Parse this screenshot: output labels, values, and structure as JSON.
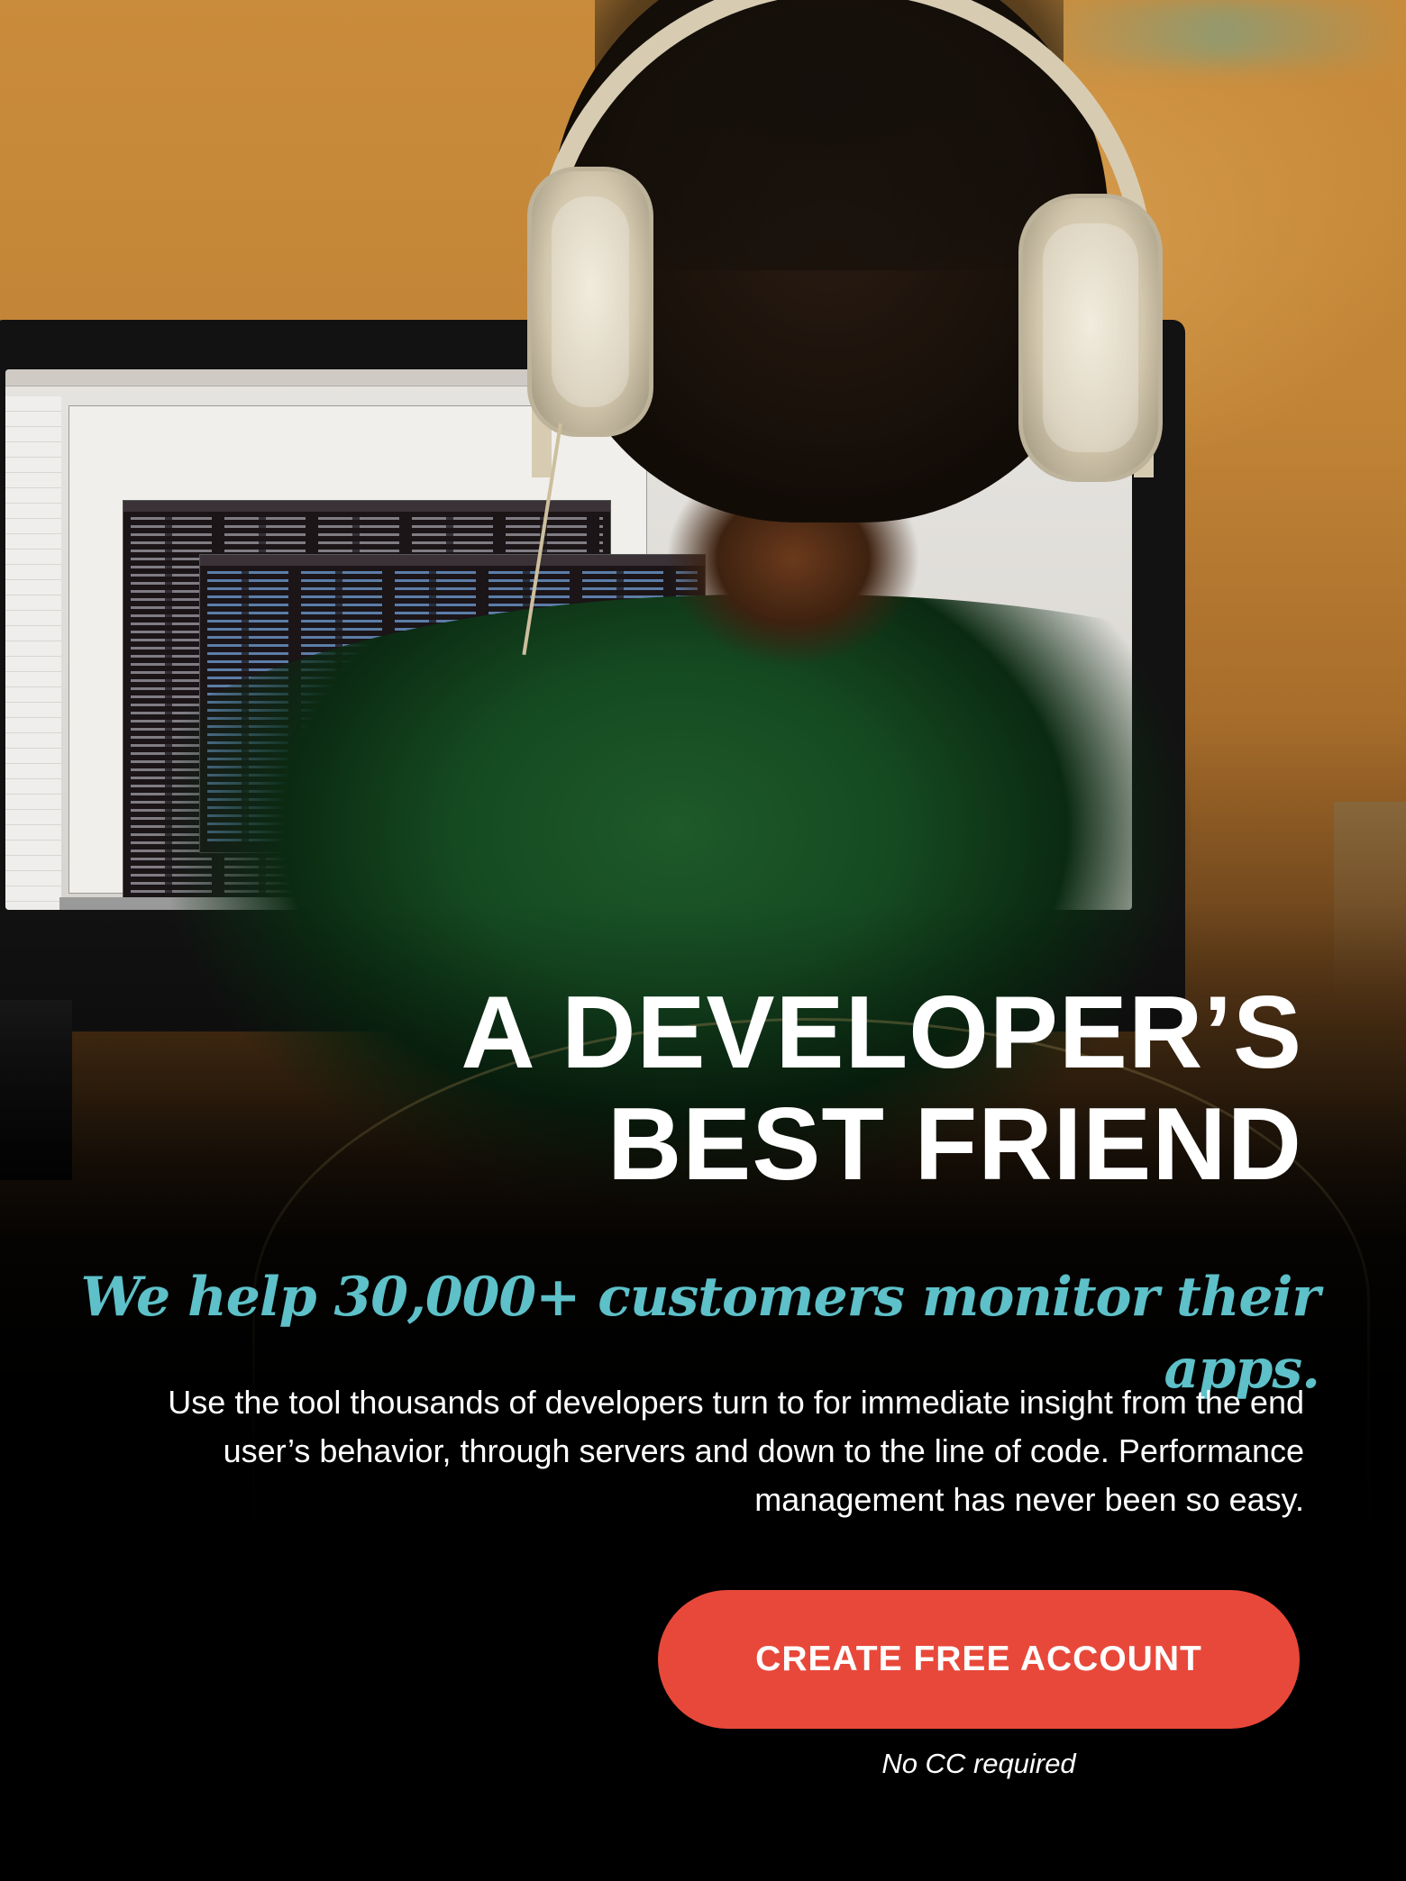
{
  "hero": {
    "headline_line1": "A DEVELOPER’S",
    "headline_line2": "BEST FRIEND",
    "tagline": "We help 30,000+ customers monitor their apps.",
    "body": "Use the tool thousands of developers turn to for immediate insight from the end user’s behavior, through servers and down to the line of code. Performance management has never been so easy.",
    "cta_label": "CREATE FREE ACCOUNT",
    "cta_note": "No CC required"
  },
  "colors": {
    "cta_background": "#e8483a",
    "tagline": "#5ec0c8",
    "headline": "#ffffff",
    "background": "#000000"
  },
  "photo": {
    "subject": "developer-with-headphones-at-monitor"
  }
}
